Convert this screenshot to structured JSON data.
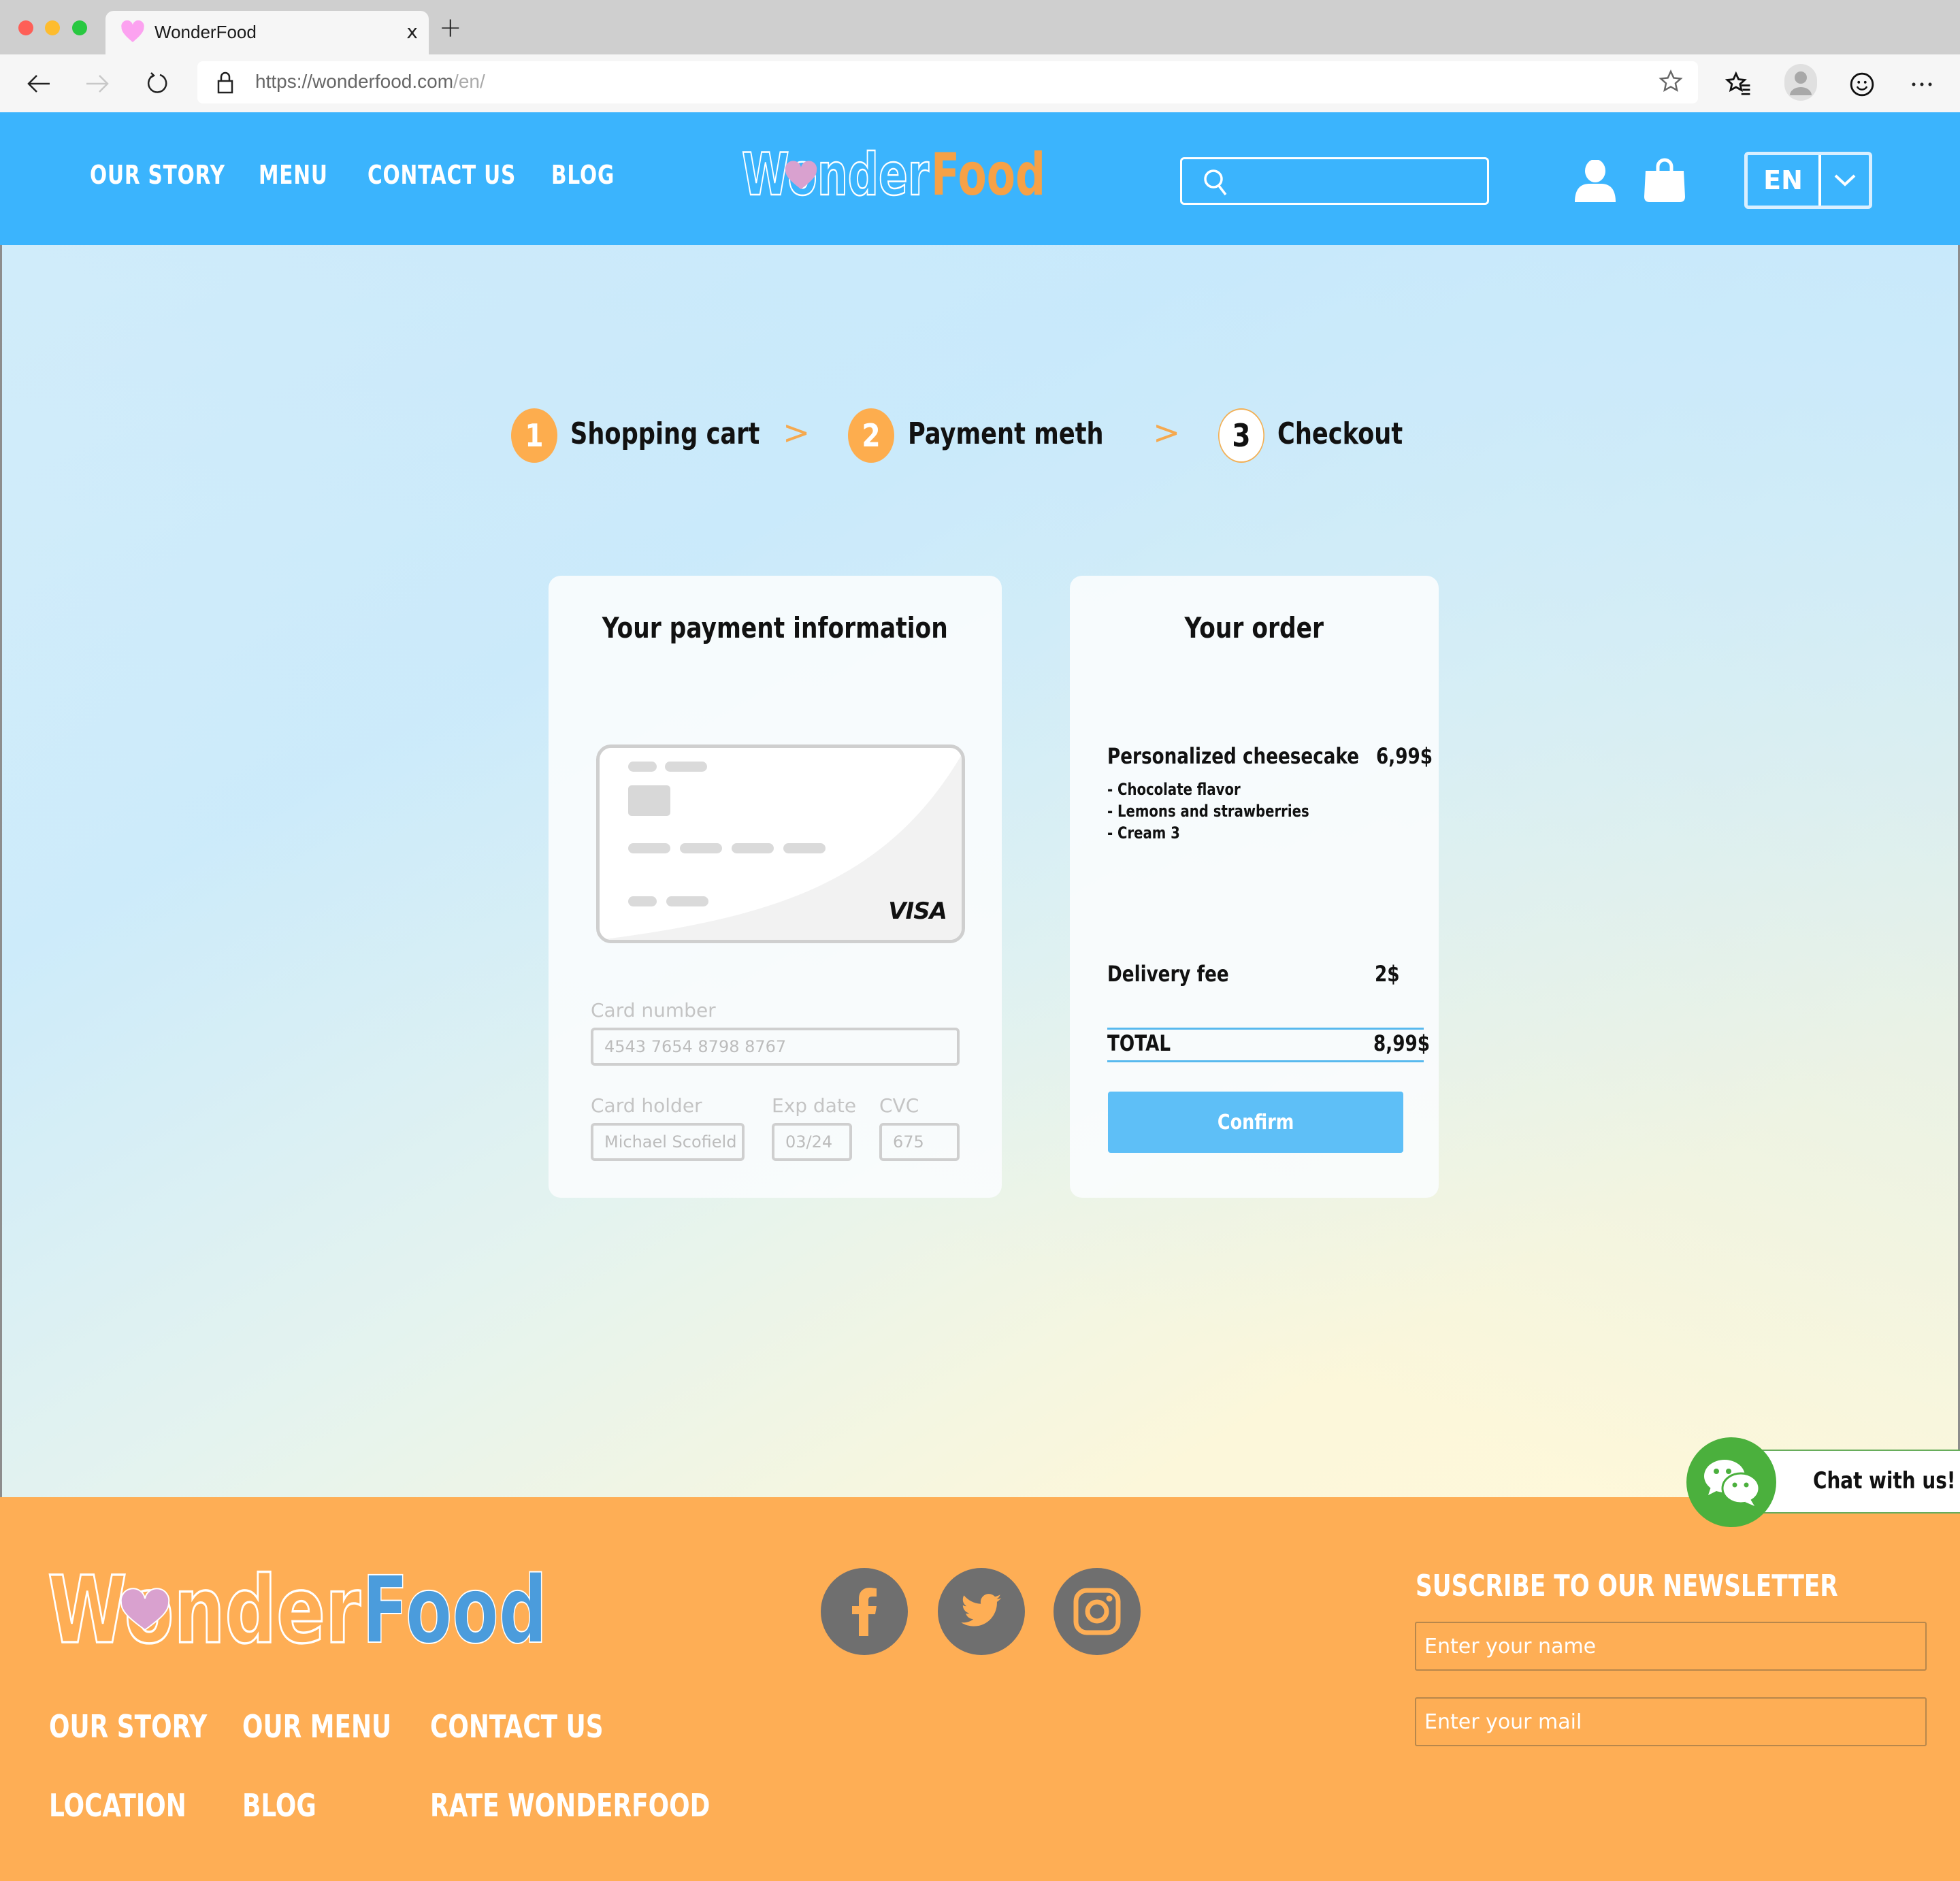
{
  "browser": {
    "tab_title": "WonderFood",
    "tab_close": "x",
    "new_tab": "+",
    "url_base": "https://wonderfood.com",
    "url_path": "/en/"
  },
  "header": {
    "nav": [
      "OUR STORY",
      "MENU",
      "CONTACT US",
      "BLOG"
    ],
    "logo_part1": "Wonder",
    "logo_part2": "Food",
    "search_placeholder": "",
    "language": "EN"
  },
  "steps": [
    {
      "number": "1",
      "label": "Shopping cart",
      "state": "done"
    },
    {
      "number": "2",
      "label": "Payment meth",
      "state": "done"
    },
    {
      "number": "3",
      "label": "Checkout",
      "state": "current"
    }
  ],
  "step_separator": ">",
  "payment": {
    "title": "Your payment information",
    "card_brand": "VISA",
    "card_number_label": "Card number",
    "card_number_placeholder": "4543 7654 8798 8767",
    "card_holder_label": "Card holder",
    "card_holder_placeholder": "Michael Scofield",
    "exp_label": "Exp date",
    "exp_placeholder": "03/24",
    "cvc_label": "CVC",
    "cvc_placeholder": "675"
  },
  "order": {
    "title": "Your order",
    "item_name": "Personalized cheesecake",
    "item_price": "6,99$",
    "options": [
      "- Chocolate flavor",
      "- Lemons and strawberries",
      "- Cream 3"
    ],
    "delivery_label": "Delivery fee",
    "delivery_price": "2$",
    "total_label": "TOTAL",
    "total_price": "8,99$",
    "confirm_label": "Confirm"
  },
  "chat": {
    "label": "Chat with us!"
  },
  "footer": {
    "logo_part1": "Wonder",
    "logo_part2": "Food",
    "links_row1": [
      "OUR STORY",
      "OUR MENU",
      "CONTACT US"
    ],
    "links_row2": [
      "LOCATION",
      "BLOG",
      "RATE WONDERFOOD"
    ],
    "newsletter_title": "SUSCRIBE TO OUR NEWSLETTER",
    "name_placeholder": "Enter your name",
    "mail_placeholder": "Enter your mail"
  },
  "colors": {
    "header_blue": "#3bb4fd",
    "accent_orange": "#fdad4e",
    "footer_orange": "#feae55",
    "confirm_blue": "#5ebff7",
    "chat_green": "#4bb03d",
    "social_gray": "#6f6f6f"
  }
}
